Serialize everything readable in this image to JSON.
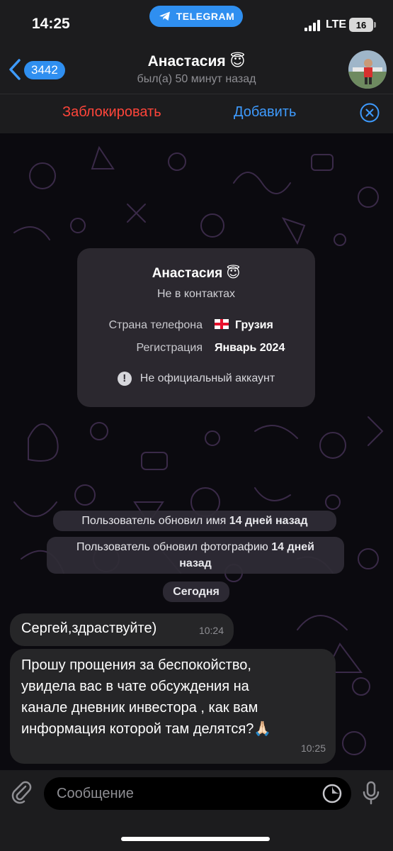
{
  "status_bar": {
    "time": "14:25",
    "app_pill": "TELEGRAM",
    "network": "LTE",
    "battery": "16"
  },
  "header": {
    "back_count": "3442",
    "title": "Анастасия 😇",
    "subtitle": "был(а) 50 минут назад",
    "avatar_icon": "user-avatar-photo"
  },
  "actions": {
    "block": "Заблокировать",
    "add": "Добавить"
  },
  "info_card": {
    "name": "Анастасия 😇",
    "status": "Не в контактах",
    "phone_country_label": "Страна телефона",
    "phone_country_value": "Грузия",
    "registration_label": "Регистрация",
    "registration_value": "Январь 2024",
    "warning": "Не официальный аккаунт"
  },
  "system_messages": {
    "name_prefix": "Пользователь обновил имя ",
    "name_time": "14 дней назад",
    "photo_prefix": "Пользователь обновил фотографию ",
    "photo_time_1": "14 дней",
    "photo_time_2": "назад",
    "date_today": "Сегодня"
  },
  "messages": [
    {
      "text": "Сергей,здраствуйте)",
      "time": "10:24"
    },
    {
      "lines": [
        "Прошу прощения за беспокойство,",
        "увидела вас в чате обсуждения на",
        "канале  дневник инвестора , как вам",
        "информация которой там делятся?🙏🏻"
      ],
      "time": "10:25"
    }
  ],
  "composer": {
    "placeholder": "Сообщение"
  },
  "colors": {
    "accent": "#2f8ff0",
    "danger": "#ff453a",
    "link": "#3e9bff"
  }
}
